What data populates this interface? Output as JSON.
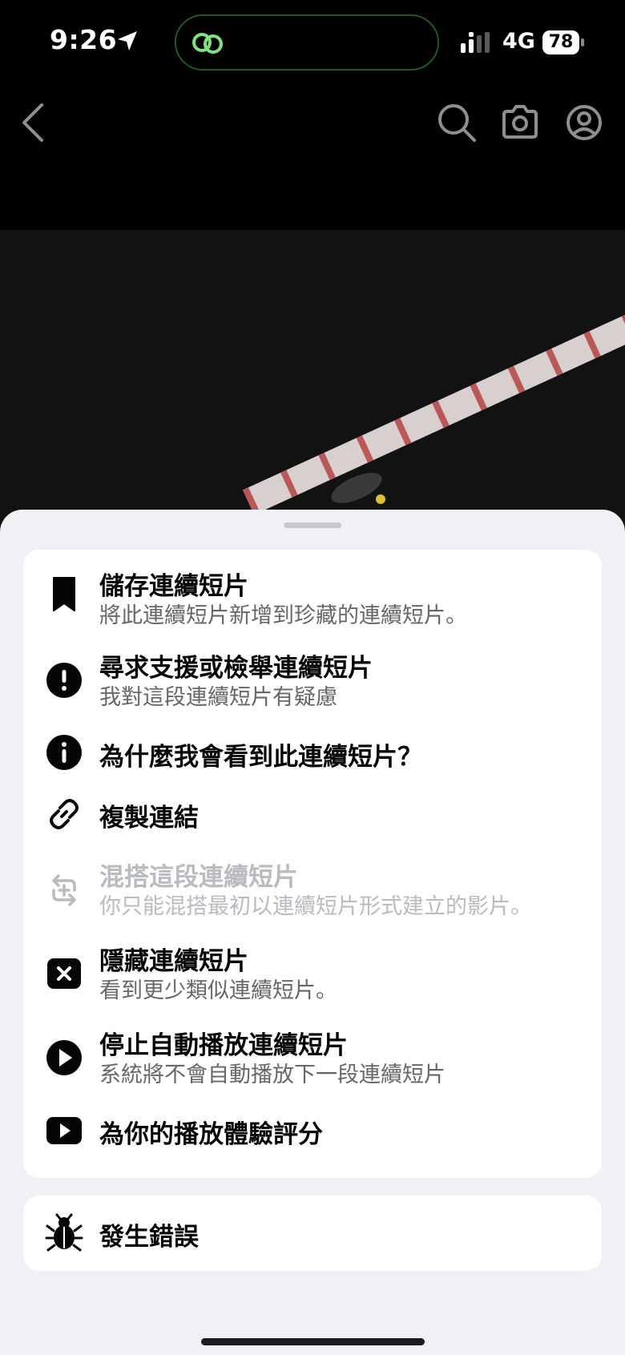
{
  "status_bar": {
    "time": "9:26",
    "network": "4G",
    "battery": "78"
  },
  "nav": {
    "icons": [
      "back-icon",
      "search-icon",
      "camera-icon",
      "profile-icon"
    ]
  },
  "menu": {
    "items": [
      {
        "icon": "bookmark-icon",
        "title": "儲存連續短片",
        "subtitle": "將此連續短片新增到珍藏的連續短片。"
      },
      {
        "icon": "exclamation-circle-icon",
        "title": "尋求支援或檢舉連續短片",
        "subtitle": "我對這段連續短片有疑慮"
      },
      {
        "icon": "info-circle-icon",
        "title": "為什麼我會看到此連續短片？",
        "subtitle": ""
      },
      {
        "icon": "link-icon",
        "title": "複製連結",
        "subtitle": ""
      },
      {
        "icon": "remix-icon",
        "title": "混搭這段連續短片",
        "subtitle": "你只能混搭最初以連續短片形式建立的影片。",
        "disabled": true
      },
      {
        "icon": "close-square-icon",
        "title": "隱藏連續短片",
        "subtitle": "看到更少類似連續短片。"
      },
      {
        "icon": "play-circle-icon",
        "title": "停止自動播放連續短片",
        "subtitle": "系統將不會自動播放下一段連續短片"
      },
      {
        "icon": "video-play-icon",
        "title": "為你的播放體驗評分",
        "subtitle": ""
      }
    ],
    "bug_item": {
      "icon": "bug-icon",
      "title": "發生錯誤"
    }
  },
  "colors": {
    "sheet_bg": "#f0f1f5",
    "text_primary": "#050505",
    "text_secondary": "#65676b",
    "text_disabled": "#b8bbbf"
  }
}
